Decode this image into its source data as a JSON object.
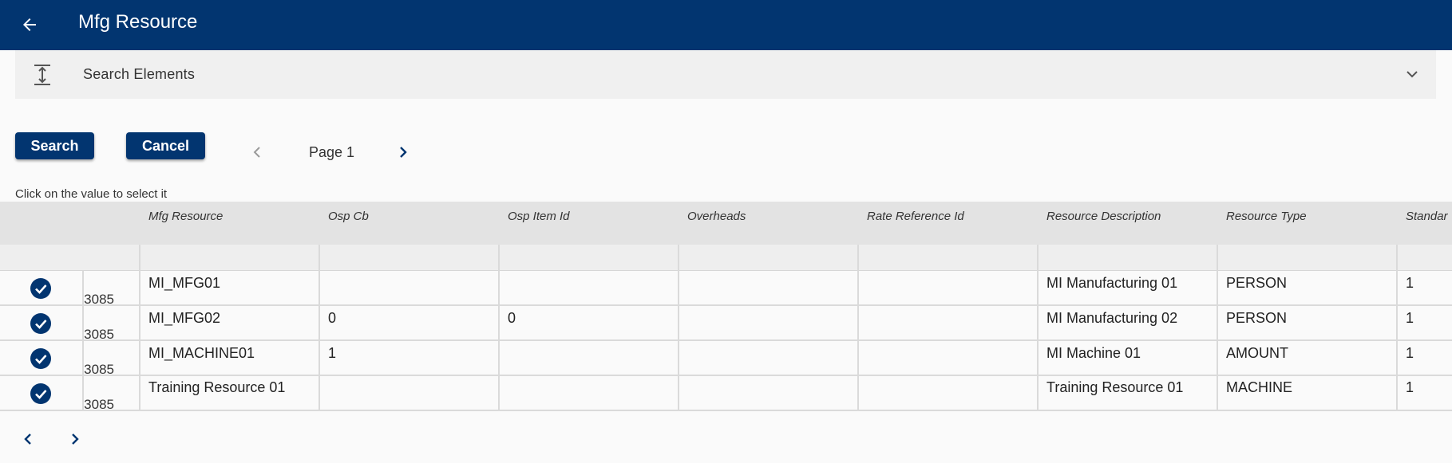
{
  "header": {
    "title": "Mfg Resource",
    "back_icon": "arrow-left-icon",
    "bg_color": "#023570"
  },
  "search_panel": {
    "label": "Search Elements",
    "left_icon": "expand-vertical-icon",
    "right_icon": "chevron-down-icon"
  },
  "actions": {
    "search_label": "Search",
    "cancel_label": "Cancel"
  },
  "pagination": {
    "page_label": "Page 1",
    "prev_icon": "chevron-left-icon",
    "next_icon": "chevron-right-icon"
  },
  "hint": "Click on the value to select it",
  "table": {
    "columns": [
      "Mfg Resource",
      "Osp Cb",
      "Osp Item Id",
      "Overheads",
      "Rate Reference Id",
      "Resource Description",
      "Resource Type",
      "Standar"
    ],
    "rows": [
      {
        "id_fragment": "3085",
        "mfg_resource": "MI_MFG01",
        "osp_cb": "",
        "osp_item_id": "",
        "overheads": "",
        "rate_reference_id": "",
        "resource_description": "MI Manufacturing 01",
        "resource_type": "PERSON",
        "standard": "1"
      },
      {
        "id_fragment": "3085",
        "mfg_resource": "MI_MFG02",
        "osp_cb": "0",
        "osp_item_id": "0",
        "overheads": "",
        "rate_reference_id": "",
        "resource_description": "MI Manufacturing 02",
        "resource_type": "PERSON",
        "standard": "1"
      },
      {
        "id_fragment": "3085",
        "mfg_resource": "MI_MACHINE01",
        "osp_cb": "1",
        "osp_item_id": "",
        "overheads": "",
        "rate_reference_id": "",
        "resource_description": "MI Machine 01",
        "resource_type": "AMOUNT",
        "standard": "1"
      },
      {
        "id_fragment": "3085",
        "mfg_resource": "Training Resource 01",
        "osp_cb": "",
        "osp_item_id": "",
        "overheads": "",
        "rate_reference_id": "",
        "resource_description": "Training Resource 01",
        "resource_type": "MACHINE",
        "standard": "1"
      }
    ],
    "row_select_icon": "check-circle-icon"
  },
  "footer": {
    "prev_icon": "chevron-left-icon",
    "next_icon": "chevron-right-icon"
  },
  "colors": {
    "primary": "#023570",
    "header_row": "#e3e3e3",
    "panel_bg": "#f0f0f0"
  }
}
